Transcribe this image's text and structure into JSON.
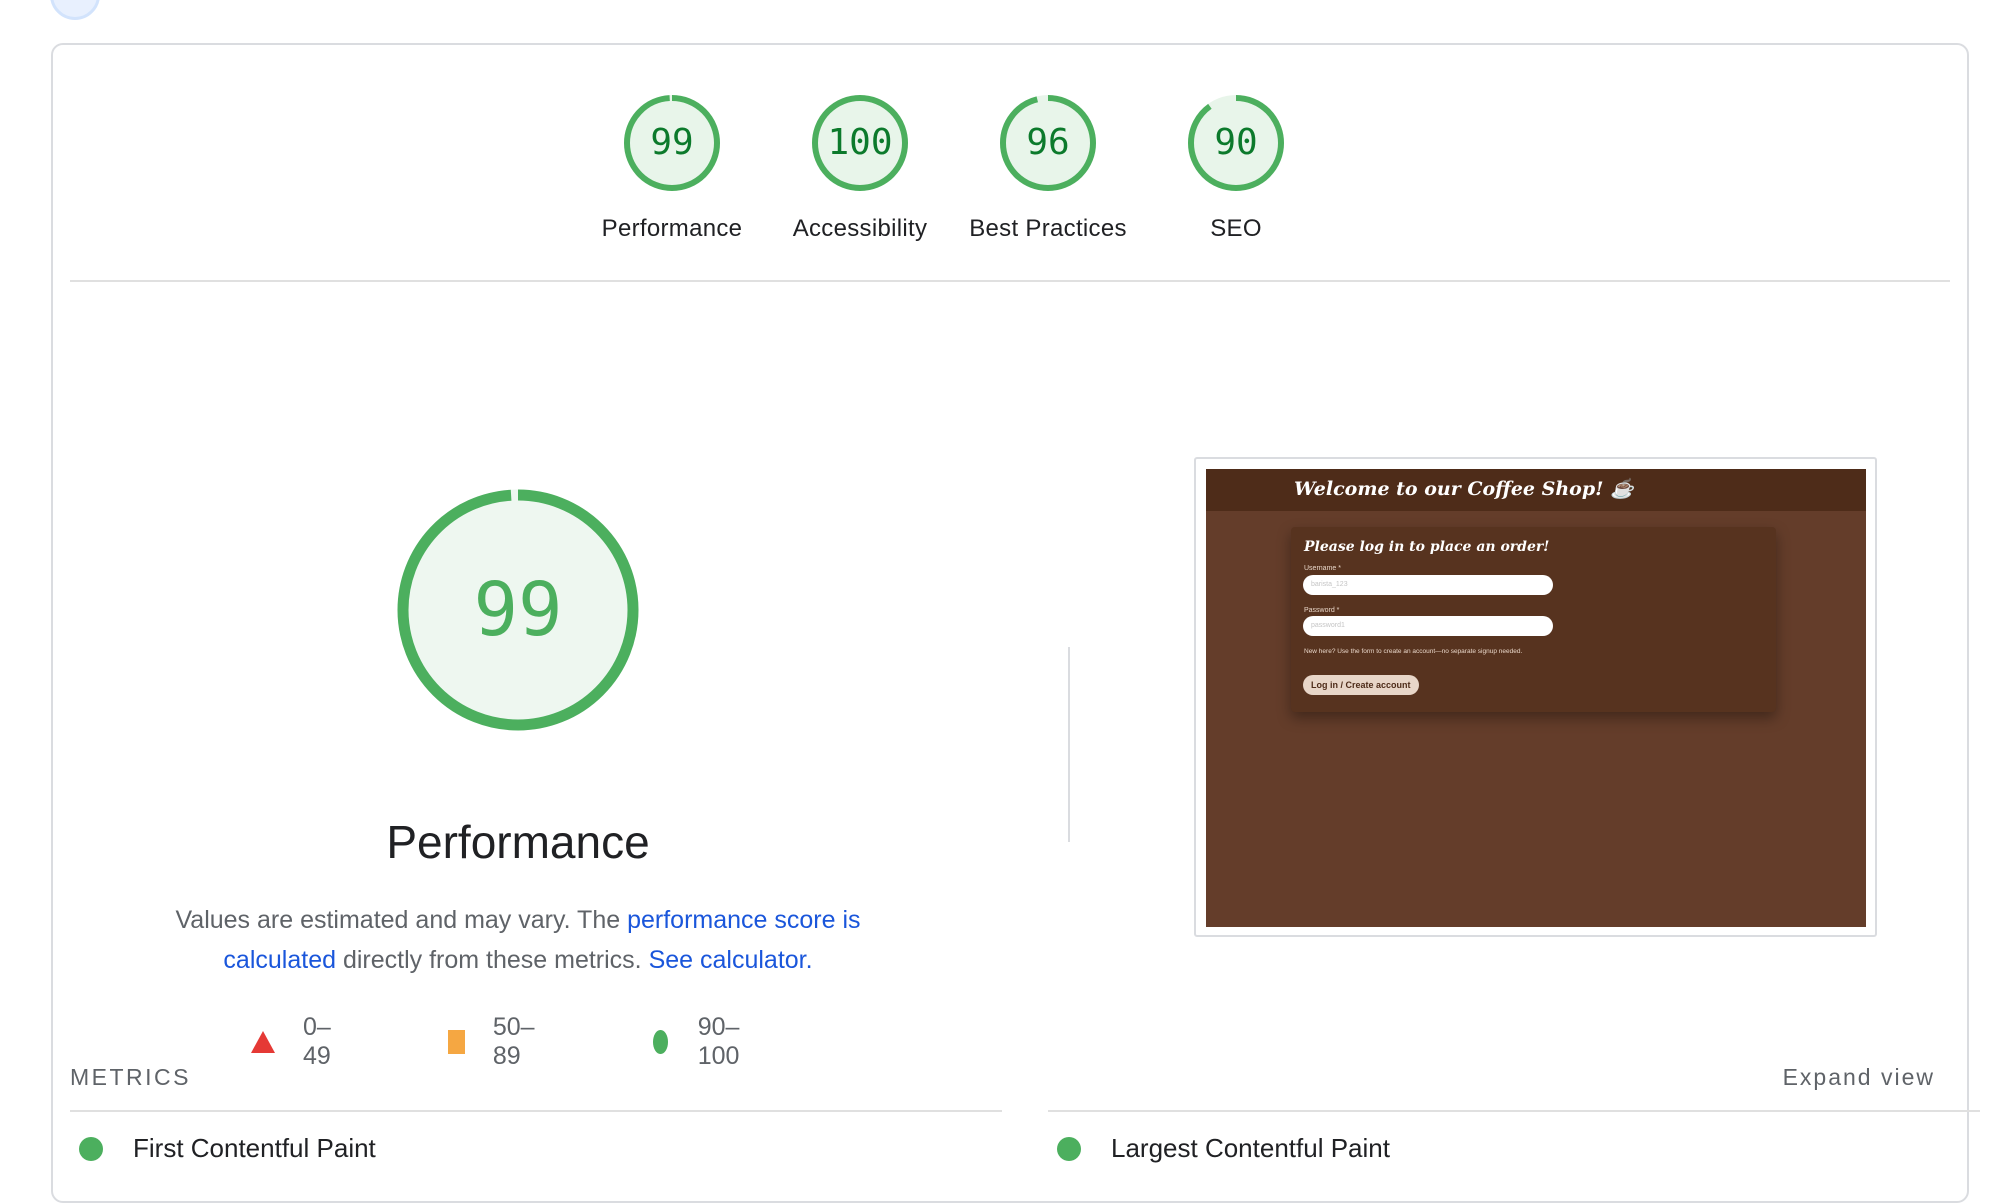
{
  "scores": [
    {
      "label": "Performance",
      "value": "99",
      "fraction": 0.99
    },
    {
      "label": "Accessibility",
      "value": "100",
      "fraction": 1.0
    },
    {
      "label": "Best Practices",
      "value": "96",
      "fraction": 0.96
    },
    {
      "label": "SEO",
      "value": "90",
      "fraction": 0.9
    }
  ],
  "main": {
    "score": "99",
    "fraction": 0.99,
    "title": "Performance",
    "desc_prefix": "Values are estimated and may vary. The ",
    "desc_link1": "performance score is calculated",
    "desc_middle": " directly from these metrics. ",
    "desc_link2": "See calculator."
  },
  "legend": [
    {
      "shape": "triangle",
      "range": "0–49",
      "color": "#e53935"
    },
    {
      "shape": "square",
      "range": "50–89",
      "color": "#f5a742"
    },
    {
      "shape": "circle",
      "range": "90–100",
      "color": "#4caf5e"
    }
  ],
  "screenshot": {
    "header_title": "Welcome to our Coffee Shop! ☕",
    "panel_title": "Please log in to place an order!",
    "username_label": "Username *",
    "username_value": "barista_123",
    "password_label": "Password *",
    "password_value": "password1",
    "hint": "New here? Use the form to create an account—no separate signup needed.",
    "button": "Log in / Create account"
  },
  "metrics": {
    "section_label": "METRICS",
    "expand_label": "Expand view",
    "items": [
      "First Contentful Paint",
      "Largest Contentful Paint"
    ]
  },
  "colors": {
    "pass": "#0c7a2c",
    "pass_ring": "#4caf5e",
    "pass_fill": "#e8f5ea",
    "link": "#1a56db"
  }
}
